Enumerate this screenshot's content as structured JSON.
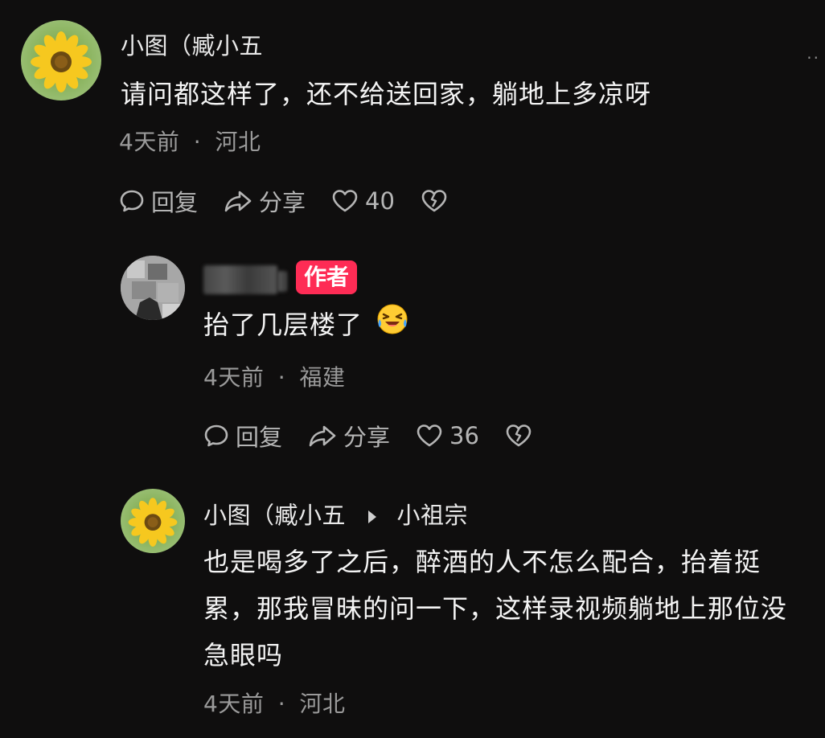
{
  "comments": [
    {
      "username": "小图（臧小五",
      "text": "请问都这样了，还不给送回家，躺地上多凉呀",
      "time": "4天前",
      "location": "河北",
      "reply_label": "回复",
      "share_label": "分享",
      "likes": "40",
      "avatar_icon": "sunflower-avatar"
    },
    {
      "badge": "作者",
      "text": "抬了几层楼了",
      "emoji": "laughing-crying-emoji",
      "time": "4天前",
      "location": "福建",
      "reply_label": "回复",
      "share_label": "分享",
      "likes": "36",
      "avatar_icon": "blurred-author-avatar"
    },
    {
      "username": "小图（臧小五",
      "reply_to": "小祖宗",
      "text_lines": [
        "也是喝多了之后，醉酒的人不怎么配合，抬着挺",
        "累，那我冒昧的问一下，这样录视频躺地上那位没",
        "急眼吗"
      ],
      "time": "4天前",
      "location": "河北",
      "avatar_icon": "sunflower-avatar"
    }
  ],
  "more_menu": "··",
  "meta_separator": "·",
  "colors": {
    "background": "#0f0e0e",
    "badge": "#fe2c55",
    "meta": "#9a9a9a"
  }
}
